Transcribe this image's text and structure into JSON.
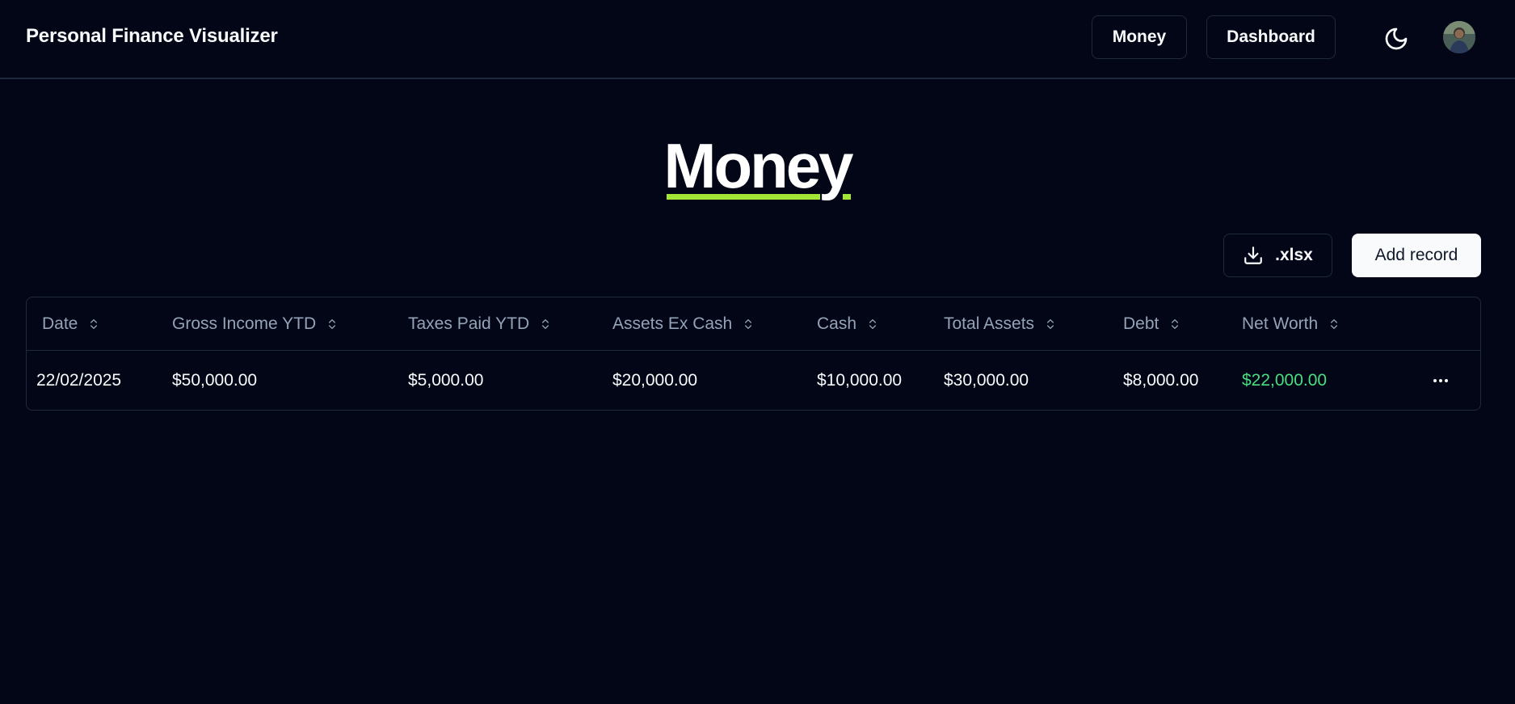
{
  "header": {
    "brand": "Personal Finance Visualizer",
    "nav": {
      "money": "Money",
      "dashboard": "Dashboard"
    },
    "theme_icon": "moon-icon",
    "avatar_icon": "user-avatar"
  },
  "page": {
    "title": "Money",
    "accent_color": "#a3e635"
  },
  "actions": {
    "export_label": ".xlsx",
    "export_icon": "download-icon",
    "add_label": "Add record"
  },
  "table": {
    "columns": [
      "Date",
      "Gross Income YTD",
      "Taxes Paid YTD",
      "Assets Ex Cash",
      "Cash",
      "Total Assets",
      "Debt",
      "Net Worth"
    ],
    "sort_icon": "chevrons-up-down-icon",
    "rows": [
      {
        "date": "22/02/2025",
        "gross_income_ytd": "$50,000.00",
        "taxes_paid_ytd": "$5,000.00",
        "assets_ex_cash": "$20,000.00",
        "cash": "$10,000.00",
        "total_assets": "$30,000.00",
        "debt": "$8,000.00",
        "net_worth": "$22,000.00"
      }
    ],
    "row_menu_icon": "more-horizontal-icon",
    "net_worth_color": "#4ade80"
  }
}
